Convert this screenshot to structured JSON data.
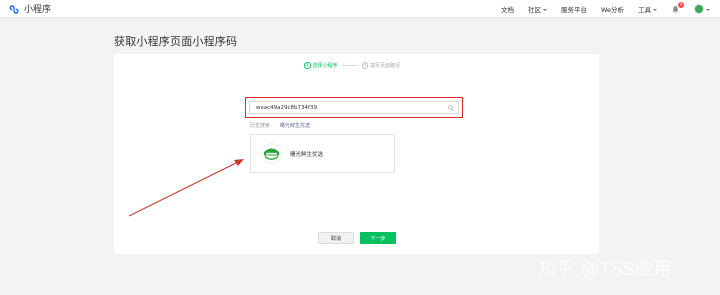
{
  "app": {
    "title": "小程序",
    "brand_color": "#07c160"
  },
  "topbar": {
    "nav": [
      {
        "label": "文档"
      },
      {
        "label": "社区"
      },
      {
        "label": "服务平台"
      },
      {
        "label": "We分析"
      },
      {
        "label": "工具"
      }
    ],
    "notification_count": "1"
  },
  "page": {
    "title": "获取小程序页面小程序码"
  },
  "steps": [
    {
      "num": "1",
      "label": "选择小程序"
    },
    {
      "num": "2",
      "label": "填写页面路径"
    }
  ],
  "search": {
    "value": "wxac49a29c8b734f39",
    "placeholder": ""
  },
  "history": {
    "label": "历史搜索",
    "link": "曙光鲜生优选"
  },
  "result": {
    "name": "曙光鲜生优选"
  },
  "buttons": {
    "cancel": "取消",
    "next": "下一步"
  },
  "watermark": "知乎 @TSS应用",
  "colors": {
    "highlight": "#d93025",
    "annotation_arrow": "#c8372d"
  }
}
